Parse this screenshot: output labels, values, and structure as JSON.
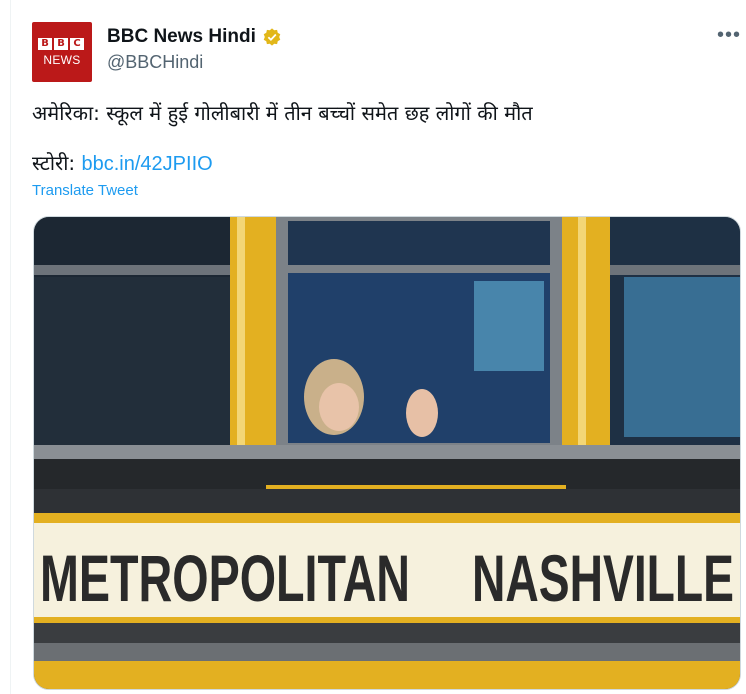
{
  "account": {
    "name": "BBC News Hindi",
    "handle": "@BBCHindi",
    "avatar_letters": [
      "B",
      "B",
      "C"
    ],
    "avatar_text": "NEWS",
    "verified_icon": "gold-verified-badge"
  },
  "menu": {
    "icon": "more-dots-icon",
    "label": "•••"
  },
  "tweet": {
    "text": "अमेरिका: स्कूल में हुई गोलीबारी में तीन बच्चों समेत छह लोगों की मौत",
    "story_label": "स्टोरी: ",
    "link": "bbc.in/42JPIIO",
    "translate": "Translate Tweet"
  },
  "media": {
    "bus_text_left": "METROPOLITAN",
    "bus_text_right": "NASHVILLE"
  },
  "colors": {
    "link": "#1d9bf0",
    "bbc_red": "#bb1919",
    "bus_yellow": "#e3b021",
    "verified_gold": "#e2b719"
  }
}
